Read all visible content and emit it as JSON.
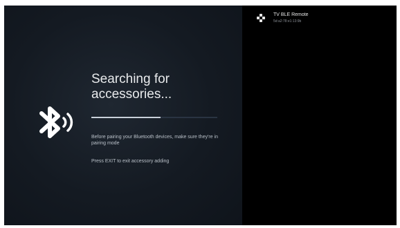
{
  "search_screen": {
    "title_line1": "Searching for",
    "title_line2": "accessories...",
    "instruction_1": "Before pairing your Bluetooth devices, make sure they're in pairing mode",
    "instruction_2": "Press EXIT to exit accessory adding",
    "progress": 0.55,
    "icon": "bluetooth-searching-icon"
  },
  "found_devices": [
    {
      "name": "TV BLE Remote",
      "address": "5d:a2:78:e1:13:9b",
      "icon": "gamepad-icon"
    }
  ],
  "colors": {
    "background_left": "#141a22",
    "background_right": "#000000",
    "title_text": "#e8eaec",
    "progress_fill": "#c9d1da"
  }
}
